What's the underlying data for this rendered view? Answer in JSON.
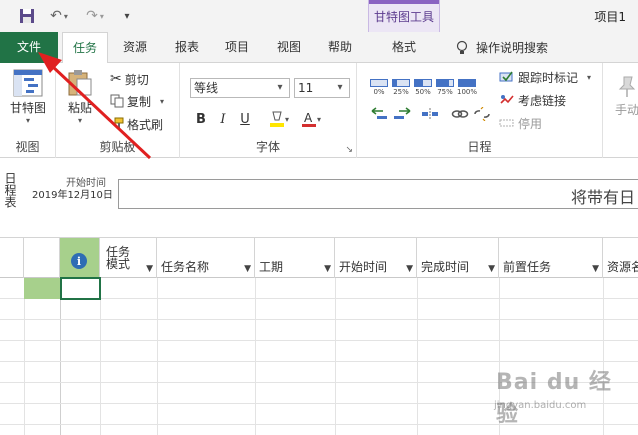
{
  "titlebar": {
    "project_title": "项目1",
    "context_tools_title": "甘特图工具"
  },
  "tabs": {
    "file": "文件",
    "task": "任务",
    "resource": "资源",
    "report": "报表",
    "project": "项目",
    "view": "视图",
    "help": "帮助",
    "format": "格式",
    "tell_me": "操作说明搜索"
  },
  "ribbon": {
    "view_group": {
      "gantt_label": "甘特图",
      "group_label": "视图"
    },
    "clipboard": {
      "paste": "粘贴",
      "cut": "剪切",
      "copy": "复制",
      "format_painter": "格式刷",
      "group_label": "剪贴板"
    },
    "font": {
      "font_name": "等线",
      "font_size": "11",
      "bold": "B",
      "italic": "I",
      "underline": "U",
      "group_label": "字体"
    },
    "schedule": {
      "pct": [
        "0%",
        "25%",
        "50%",
        "75%",
        "100%"
      ],
      "mark_on_track": "跟踪时标记",
      "respect_links": "考虑链接",
      "inactivate": "停用",
      "group_label": "日程"
    },
    "manual": "手动"
  },
  "timeline": {
    "side_label": "日程表",
    "start_label": "开始时间",
    "start_date": "2019年12月10日",
    "box_text": "将带有日"
  },
  "grid": {
    "columns": [
      {
        "label": "任务\n模式",
        "key": "mode"
      },
      {
        "label": "任务名称",
        "key": "name"
      },
      {
        "label": "工期",
        "key": "duration"
      },
      {
        "label": "开始时间",
        "key": "start"
      },
      {
        "label": "完成时间",
        "key": "finish"
      },
      {
        "label": "前置任务",
        "key": "pred"
      },
      {
        "label": "资源名",
        "key": "res"
      }
    ]
  },
  "watermark": {
    "brand": "Bai du 经验",
    "url": "jingyan.baidu.com"
  },
  "colors": {
    "accent": "#217346",
    "context": "#8a63c2",
    "annotation": "#e02020"
  }
}
